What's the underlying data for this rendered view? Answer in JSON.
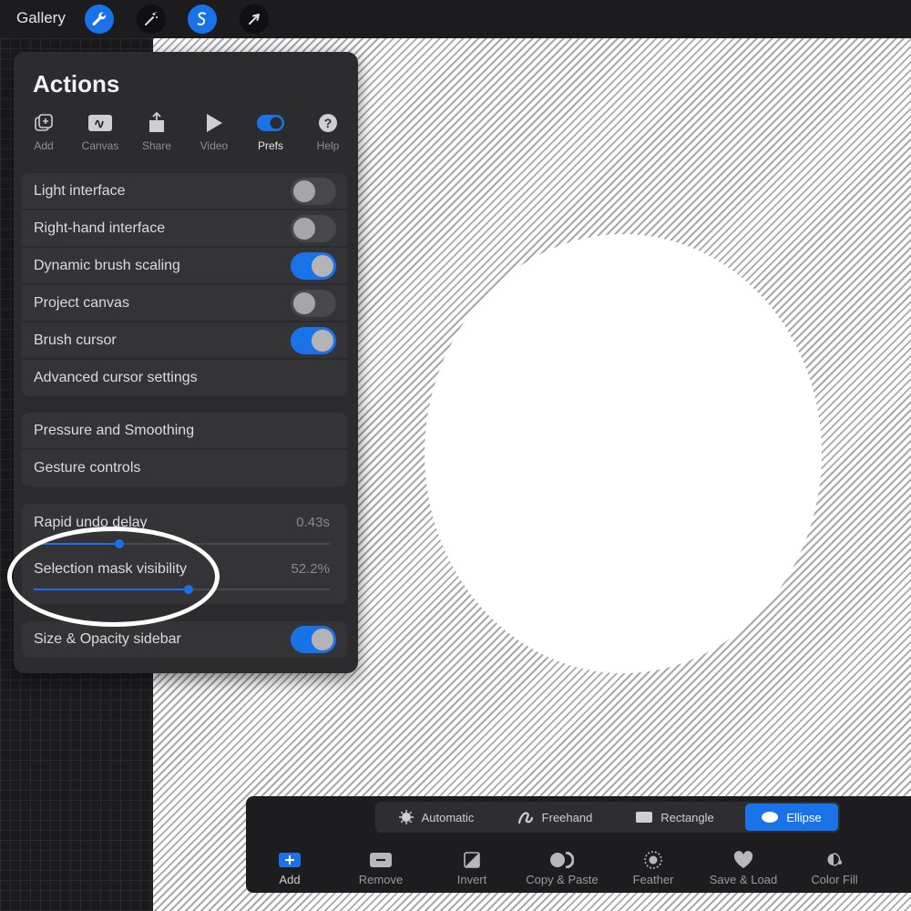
{
  "topbar": {
    "gallery_label": "Gallery",
    "tools": [
      {
        "icon": "wrench-icon",
        "active": true
      },
      {
        "icon": "magic-wand-icon",
        "active": false
      },
      {
        "icon": "selection-icon",
        "active": true
      },
      {
        "icon": "transform-arrow-icon",
        "active": false
      }
    ]
  },
  "actions": {
    "title": "Actions",
    "tabs": [
      {
        "label": "Add",
        "icon": "add-icon"
      },
      {
        "label": "Canvas",
        "icon": "canvas-icon"
      },
      {
        "label": "Share",
        "icon": "share-icon"
      },
      {
        "label": "Video",
        "icon": "play-icon"
      },
      {
        "label": "Prefs",
        "icon": "toggle-icon",
        "selected": true
      },
      {
        "label": "Help",
        "icon": "help-icon"
      }
    ],
    "prefs": [
      {
        "label": "Light interface",
        "on": false
      },
      {
        "label": "Right-hand interface",
        "on": false
      },
      {
        "label": "Dynamic brush scaling",
        "on": true
      },
      {
        "label": "Project canvas",
        "on": false
      },
      {
        "label": "Brush cursor",
        "on": true
      },
      {
        "label": "Advanced cursor settings"
      }
    ],
    "links": [
      "Pressure and Smoothing",
      "Gesture controls"
    ],
    "sliders": [
      {
        "label": "Rapid undo delay",
        "value": "0.43s",
        "fraction": 0.29
      },
      {
        "label": "Selection mask visibility",
        "value": "52.2%",
        "fraction": 0.522
      }
    ],
    "sidebar_toggle": {
      "label": "Size & Opacity sidebar",
      "on": true
    }
  },
  "selection_toolbar": {
    "modes": [
      {
        "label": "Automatic",
        "icon": "automatic-icon"
      },
      {
        "label": "Freehand",
        "icon": "freehand-icon"
      },
      {
        "label": "Rectangle",
        "icon": "rectangle-icon"
      },
      {
        "label": "Ellipse",
        "icon": "ellipse-icon",
        "selected": true
      }
    ],
    "actions": [
      {
        "label": "Add",
        "icon": "plus-icon",
        "selected": true
      },
      {
        "label": "Remove",
        "icon": "minus-icon"
      },
      {
        "label": "Invert",
        "icon": "invert-icon"
      },
      {
        "label": "Copy & Paste",
        "icon": "copy-paste-icon"
      },
      {
        "label": "Feather",
        "icon": "feather-icon"
      },
      {
        "label": "Save & Load",
        "icon": "heart-icon"
      },
      {
        "label": "Color Fill",
        "icon": "color-fill-icon"
      }
    ]
  },
  "colors": {
    "accent": "#1a72e8",
    "panel": "#2c2c2e",
    "row": "#343437"
  }
}
